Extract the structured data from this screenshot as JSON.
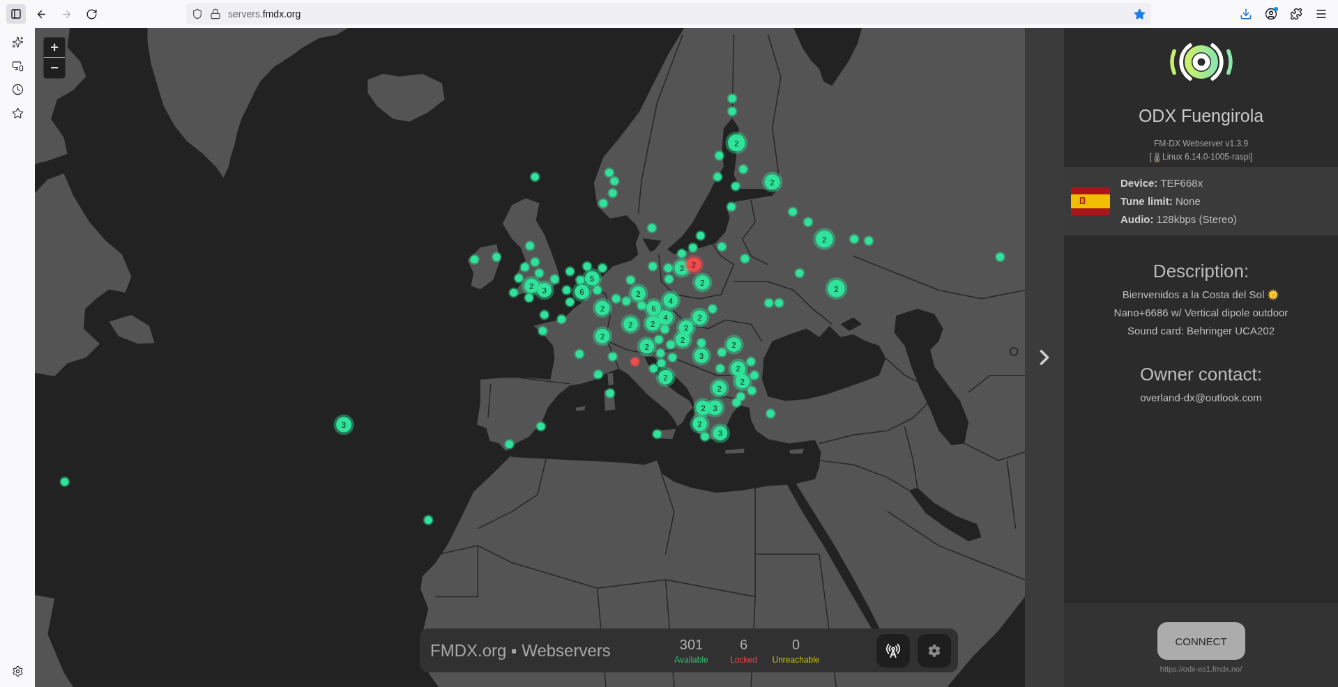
{
  "browser": {
    "sidebar_toggle_selected": true,
    "nav_buttons": [
      {
        "kind": "back",
        "disabled": false
      },
      {
        "kind": "forward",
        "disabled": true
      },
      {
        "kind": "reload",
        "disabled": false
      }
    ],
    "url": {
      "subdomain": "servers.",
      "domain": "fmdx.org"
    },
    "bookmarked": true,
    "toolbar_buttons": [
      {
        "kind": "downloads",
        "active": true,
        "badge": false
      },
      {
        "kind": "account",
        "active": false,
        "badge": true
      },
      {
        "kind": "extensions",
        "active": false,
        "badge": false
      },
      {
        "kind": "menu",
        "active": false,
        "badge": false
      }
    ]
  },
  "sidebar": {
    "items": [
      {
        "kind": "assistant"
      },
      {
        "kind": "synced_tabs"
      },
      {
        "kind": "history"
      },
      {
        "kind": "bookmarks"
      }
    ],
    "footer": {
      "kind": "settings"
    }
  },
  "map": {
    "zoom_controls": [
      {
        "label": "+"
      },
      {
        "label": "−"
      }
    ],
    "points": [
      {
        "color": "#2fe39b"
      },
      {
        "color": "#2fe39b"
      },
      {
        "color": "#2fe39b"
      },
      {
        "color": "#2fe39b"
      },
      {
        "color": "#2fe39b"
      },
      {
        "color": "#2fe39b"
      },
      {
        "color": "#2fe39b"
      },
      {
        "color": "#2fe39b"
      },
      {
        "color": "#2fe39b"
      },
      {
        "color": "#2fe39b"
      },
      {
        "color": "#2fe39b"
      },
      {
        "color": "#2fe39b"
      },
      {
        "color": "#2fe39b"
      },
      {
        "color": "#2fe39b"
      },
      {
        "color": "#2fe39b"
      },
      {
        "color": "#2fe39b"
      },
      {
        "color": "#2fe39b"
      },
      {
        "color": "#2fe39b"
      },
      {
        "color": "#2fe39b"
      },
      {
        "color": "#2fe39b"
      },
      {
        "color": "#2fe39b"
      },
      {
        "color": "#2fe39b"
      },
      {
        "color": "#2fe39b"
      },
      {
        "color": "#2fe39b"
      },
      {
        "color": "#2fe39b"
      },
      {
        "color": "#2fe39b"
      },
      {
        "color": "#2fe39b"
      },
      {
        "color": "#2fe39b"
      },
      {
        "color": "#2fe39b"
      },
      {
        "color": "#2fe39b"
      },
      {
        "color": "#2fe39b"
      },
      {
        "color": "#2fe39b"
      },
      {
        "color": "#2fe39b"
      },
      {
        "color": "#2fe39b"
      },
      {
        "color": "#2fe39b"
      },
      {
        "color": "#2fe39b"
      },
      {
        "color": "#f24b4b"
      },
      {
        "color": "#2fe39b"
      },
      {
        "color": "#2fe39b"
      },
      {
        "color": "#2fe39b"
      },
      {
        "color": "#2fe39b"
      },
      {
        "color": "#2fe39b"
      },
      {
        "color": "#2fe39b"
      },
      {
        "color": "#2fe39b"
      },
      {
        "color": "#2fe39b"
      },
      {
        "color": "#2fe39b"
      },
      {
        "color": "#2fe39b"
      },
      {
        "color": "#2fe39b"
      },
      {
        "color": "#2fe39b"
      },
      {
        "color": "#2fe39b"
      },
      {
        "color": "#2fe39b"
      },
      {
        "color": "#2fe39b"
      },
      {
        "color": "#2fe39b"
      },
      {
        "color": "#2fe39b"
      },
      {
        "color": "#2fe39b"
      },
      {
        "color": "#2fe39b"
      },
      {
        "color": "#2fe39b"
      },
      {
        "color": "#2fe39b"
      },
      {
        "color": "#2fe39b"
      },
      {
        "color": "#2fe39b"
      },
      {
        "color": "#2fe39b"
      },
      {
        "color": "#2fe39b"
      },
      {
        "color": "#2fe39b"
      },
      {
        "color": "#2fe39b"
      },
      {
        "color": "#2fe39b"
      },
      {
        "color": "#2fe39b"
      },
      {
        "color": "#2fe39b"
      },
      {
        "color": "#2fe39b"
      },
      {
        "color": "#2fe39b"
      },
      {
        "color": "#2fe39b"
      },
      {
        "color": "#2fe39b"
      },
      {
        "color": "#2fe39b"
      },
      {
        "color": "#2fe39b"
      },
      {
        "color": "#2fe39b"
      },
      {
        "color": "#2fe39b"
      },
      {
        "color": "#2fe39b"
      },
      {
        "color": "#2fe39b"
      },
      {
        "color": "#2fe39b"
      },
      {
        "color": "#2fe39b"
      },
      {
        "color": "#2fe39b"
      },
      {
        "color": "#2fe39b"
      }
    ],
    "clusters": [
      {
        "count": "2",
        "color": "#2fe39b"
      },
      {
        "count": "2",
        "color": "#2fe39b"
      },
      {
        "count": "2",
        "color": "#2fe39b"
      },
      {
        "count": "2",
        "color": "#2fe39b"
      },
      {
        "count": "3",
        "color": "#2fe39b"
      },
      {
        "count": "2",
        "color": "#2fe39b"
      },
      {
        "count": "3",
        "color": "#2fe39b"
      },
      {
        "count": "6",
        "color": "#2fe39b"
      },
      {
        "count": "5",
        "color": "#2fe39b"
      },
      {
        "count": "2",
        "color": "#2fe39b"
      },
      {
        "count": "2",
        "color": "#2fe39b"
      },
      {
        "count": "6",
        "color": "#2fe39b"
      },
      {
        "count": "4",
        "color": "#2fe39b"
      },
      {
        "count": "4",
        "color": "#2fe39b"
      },
      {
        "count": "2",
        "color": "#2fe39b"
      },
      {
        "count": "2",
        "color": "#2fe39b"
      },
      {
        "count": "2",
        "color": "#2fe39b"
      },
      {
        "count": "3",
        "color": "#2fe39b"
      },
      {
        "count": "2",
        "color": "#f24b4b"
      },
      {
        "count": "2",
        "color": "#2fe39b"
      },
      {
        "count": "2",
        "color": "#2fe39b"
      },
      {
        "count": "2",
        "color": "#2fe39b"
      },
      {
        "count": "2",
        "color": "#2fe39b"
      },
      {
        "count": "2",
        "color": "#2fe39b"
      },
      {
        "count": "3",
        "color": "#2fe39b"
      },
      {
        "count": "2",
        "color": "#2fe39b"
      },
      {
        "count": "2",
        "color": "#2fe39b"
      },
      {
        "count": "2",
        "color": "#2fe39b"
      },
      {
        "count": "2",
        "color": "#2fe39b"
      },
      {
        "count": "2",
        "color": "#2fe39b"
      },
      {
        "count": "2",
        "color": "#2fe39b"
      },
      {
        "count": "3",
        "color": "#2fe39b"
      },
      {
        "count": "2",
        "color": "#2fe39b"
      },
      {
        "count": "3",
        "color": "#2fe39b"
      }
    ]
  },
  "status_bar": {
    "title": "FMDX.org ▪ Webservers",
    "stats": [
      {
        "value": "301",
        "label": "Available",
        "color": "#34c472"
      },
      {
        "value": "6",
        "label": "Locked",
        "color": "#e0504c"
      },
      {
        "value": "0",
        "label": "Unreachable",
        "color": "#c8c21e"
      }
    ],
    "buttons": [
      {
        "kind": "antenna"
      },
      {
        "kind": "settings"
      }
    ]
  },
  "server": {
    "name": "ODX Fuengirola",
    "version": "FM-DX Webserver v1.3.9",
    "os": {
      "prefix": "[",
      "text": "Linux 6.14.0-1005-raspi]"
    },
    "details": [
      "**Device:** TEF668x",
      "**Tune limit:** None",
      "**Audio:** 128kbps (Stereo)"
    ],
    "description": {
      "heading": "Description:",
      "lines": [
        {
          "text": "Bienvenidos a la Costa del Sol",
          "emoji": true
        },
        {
          "text": "Nano+6686 w/ Vertical dipole outdoor",
          "emoji": false
        },
        {
          "text": "Sound card: Behringer UCA202",
          "emoji": false
        }
      ]
    },
    "contact": {
      "heading": "Owner contact:",
      "email": "overland-dx@outlook.com"
    },
    "connect": {
      "label": "CONNECT",
      "url": "https://odx-es1.fmdx.no/"
    }
  }
}
